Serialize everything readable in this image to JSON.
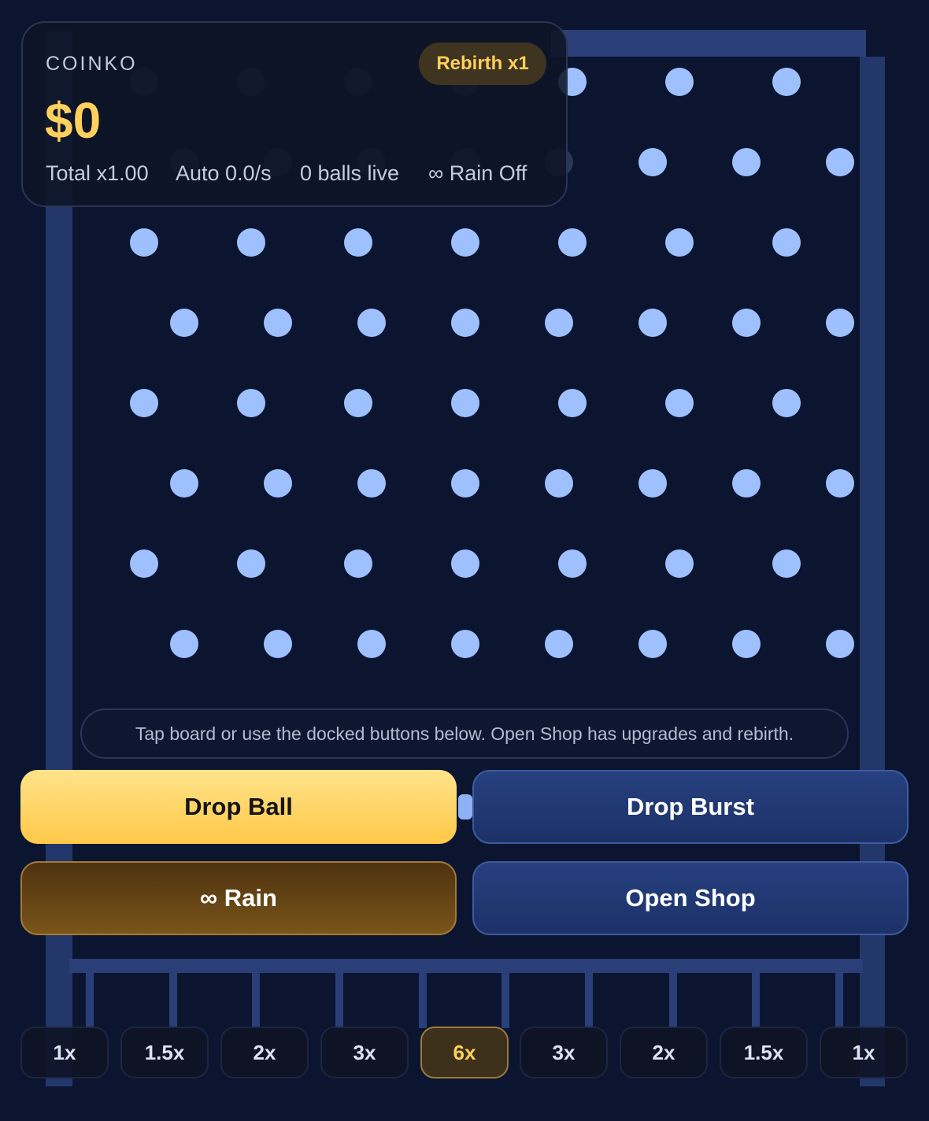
{
  "hud": {
    "brand": "COINKO",
    "balance": "$0",
    "rebirth_badge": "Rebirth x1",
    "stats": {
      "total": "Total x1.00",
      "auto": "Auto 0.0/s",
      "balls_live": "0 balls live",
      "rain": "∞ Rain Off"
    }
  },
  "hint": "Tap board or use the docked buttons below. Open Shop has upgrades and rebirth.",
  "actions": {
    "drop_ball": "Drop Ball",
    "drop_burst": "Drop Burst",
    "rain": "∞ Rain",
    "open_shop": "Open Shop"
  },
  "slots": [
    {
      "label": "1x",
      "highlight": false
    },
    {
      "label": "1.5x",
      "highlight": false
    },
    {
      "label": "2x",
      "highlight": false
    },
    {
      "label": "3x",
      "highlight": false
    },
    {
      "label": "6x",
      "highlight": true
    },
    {
      "label": "3x",
      "highlight": false
    },
    {
      "label": "2x",
      "highlight": false
    },
    {
      "label": "1.5x",
      "highlight": false
    },
    {
      "label": "1x",
      "highlight": false
    }
  ],
  "colors": {
    "background": "#0b1530",
    "peg": "#9ec0ff",
    "gold": "#ffd15c",
    "frame": "#2a3f78"
  }
}
